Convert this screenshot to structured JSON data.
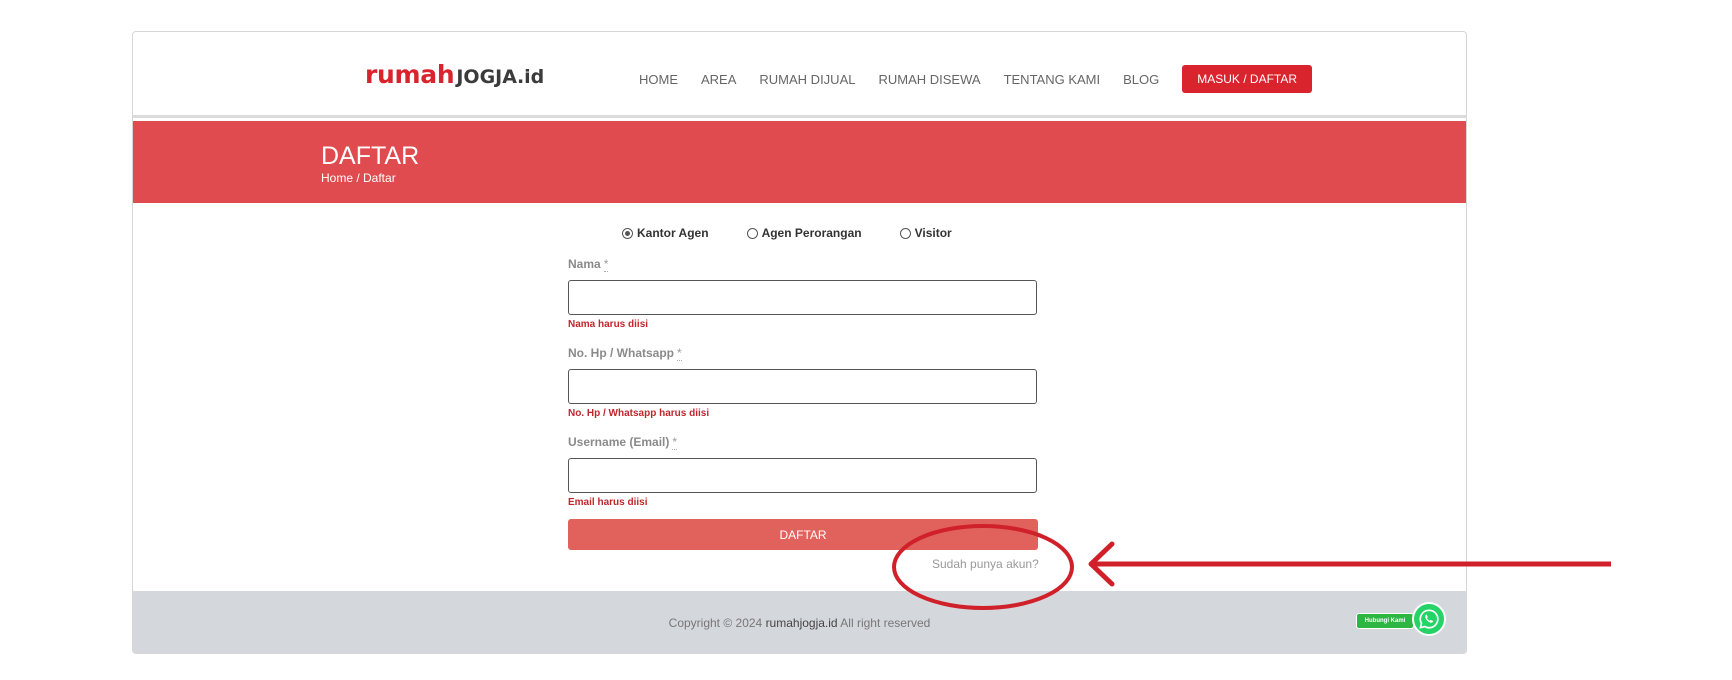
{
  "header": {
    "logo": {
      "part1": "rumah",
      "part2": "JOGJA",
      "part3": ".id"
    },
    "nav": [
      "HOME",
      "AREA",
      "RUMAH DIJUAL",
      "RUMAH DISEWA",
      "TENTANG KAMI",
      "BLOG"
    ],
    "cta_label": "MASUK / DAFTAR"
  },
  "banner": {
    "title": "DAFTAR",
    "breadcrumb": "Home / Daftar"
  },
  "form": {
    "account_types": [
      {
        "label": "Kantor Agen",
        "selected": true
      },
      {
        "label": "Agen Perorangan",
        "selected": false
      },
      {
        "label": "Visitor",
        "selected": false
      }
    ],
    "fields": [
      {
        "label": "Nama",
        "required_mark": "*",
        "value": "",
        "error": "Nama harus diisi"
      },
      {
        "label": "No. Hp / Whatsapp",
        "required_mark": "*",
        "value": "",
        "error": "No. Hp / Whatsapp harus diisi"
      },
      {
        "label": "Username (Email)",
        "required_mark": "*",
        "value": "",
        "error": "Email harus diisi"
      }
    ],
    "submit_label": "DAFTAR",
    "login_link": "Sudah punya akun?"
  },
  "footer": {
    "copyright_prefix": "Copyright © 2024",
    "brand": "rumahjogja.id",
    "copyright_suffix": "All right reserved",
    "whatsapp_label": "Hubungi Kami"
  },
  "colors": {
    "brand_red": "#d9232d",
    "banner_red": "#df4b4e",
    "submit_red": "#e1625d",
    "annotation_red": "#d0202a",
    "footer_gray": "#d4d7dc",
    "whatsapp_green": "#25d366"
  },
  "icons": [
    "radio-selected-icon",
    "radio-unselected-icon",
    "whatsapp-icon"
  ]
}
